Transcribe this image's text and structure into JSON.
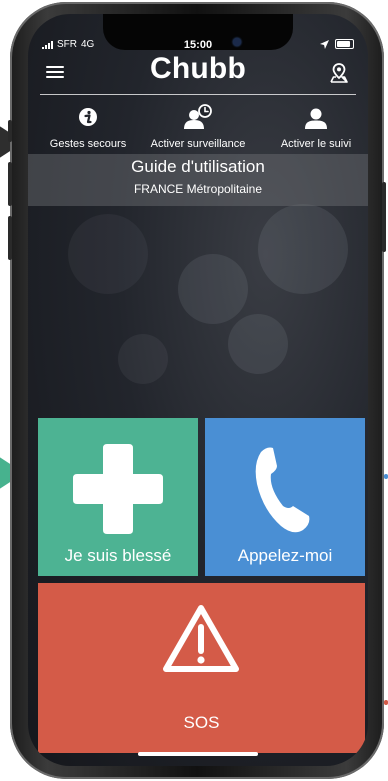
{
  "status_bar": {
    "carrier": "SFR",
    "network": "4G",
    "time": "15:00"
  },
  "header": {
    "brand": "Chubb",
    "menu_icon": "hamburger-menu-icon",
    "location_icon": "map-pin-icon"
  },
  "tabs": [
    {
      "label": "Gestes secours",
      "icon": "info-icon"
    },
    {
      "label": "Activer surveillance",
      "icon": "user-clock-icon"
    },
    {
      "label": "Activer le suivi",
      "icon": "user-icon"
    }
  ],
  "guide": {
    "title": "Guide d'utilisation",
    "subtitle": "FRANCE Métropolitaine"
  },
  "actions": {
    "injured": {
      "label": "Je suis blessé",
      "icon": "medical-cross-icon",
      "color": "#4db393"
    },
    "call_me": {
      "label": "Appelez-moi",
      "icon": "phone-icon",
      "color": "#4a8fd4"
    },
    "sos": {
      "label": "SOS",
      "icon": "warning-triangle-icon",
      "color": "#d45b48"
    }
  }
}
